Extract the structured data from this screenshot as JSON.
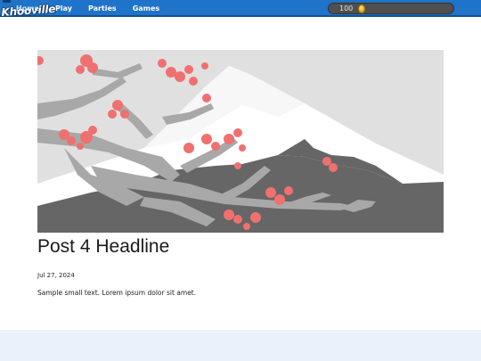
{
  "header": {
    "logo_text": "Khooville",
    "nav": [
      {
        "label": "Home"
      },
      {
        "label": "Play"
      },
      {
        "label": "Parties"
      },
      {
        "label": "Games"
      }
    ],
    "coins": {
      "value": "100"
    }
  },
  "post": {
    "image_icon": "mountain-blossom-illustration",
    "headline": "Post 4 Headline",
    "date": "Jul 27, 2024",
    "excerpt": "Sample small text. Lorem ipsum dolor sit amet."
  },
  "colors": {
    "header_bg": "#1f73c9",
    "footer_band": "#eaf1fb",
    "blossom": "#f07070",
    "mountain": "#ffffff",
    "ground": "#666666",
    "branch": "#a8a8a8"
  }
}
